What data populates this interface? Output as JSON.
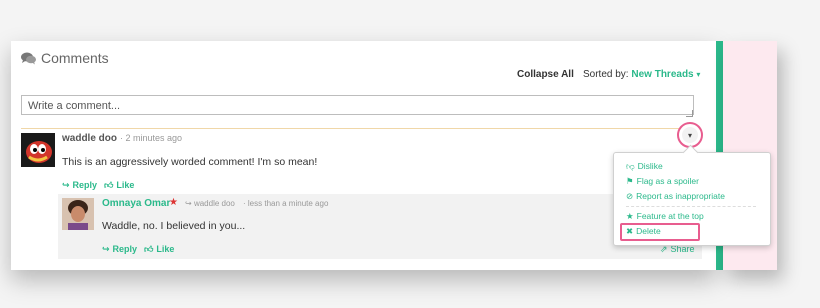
{
  "header": {
    "title": "Comments",
    "collapse_label": "Collapse All",
    "sorted_label": "Sorted by:",
    "sorted_value": "New Threads"
  },
  "composer": {
    "placeholder": "Write a comment..."
  },
  "comments": [
    {
      "author": "waddle doo",
      "time": "2 minutes ago",
      "body": "This is an aggressively worded comment! I'm so mean!",
      "reply_label": "Reply",
      "like_label": "Like"
    }
  ],
  "reply": {
    "author": "Omnaya Omar",
    "reply_to": "waddle doo",
    "time": "less than a minute ago",
    "body": "Waddle, no. I believed in you...",
    "reply_label": "Reply",
    "like_label": "Like",
    "share_label": "Share"
  },
  "menu": {
    "items": [
      "Dislike",
      "Flag as a spoiler",
      "Report as inappropriate",
      "Feature at the top",
      "Delete"
    ]
  },
  "colors": {
    "accent": "#2bb98b",
    "highlight": "#e85d8f",
    "side_panel": "#fde9ef"
  },
  "icons": [
    "comments-icon",
    "reply-icon",
    "like-icon",
    "thumbs-down-icon",
    "flag-icon",
    "ban-icon",
    "star-icon",
    "close-icon",
    "share-icon",
    "chevron-down-icon"
  ]
}
